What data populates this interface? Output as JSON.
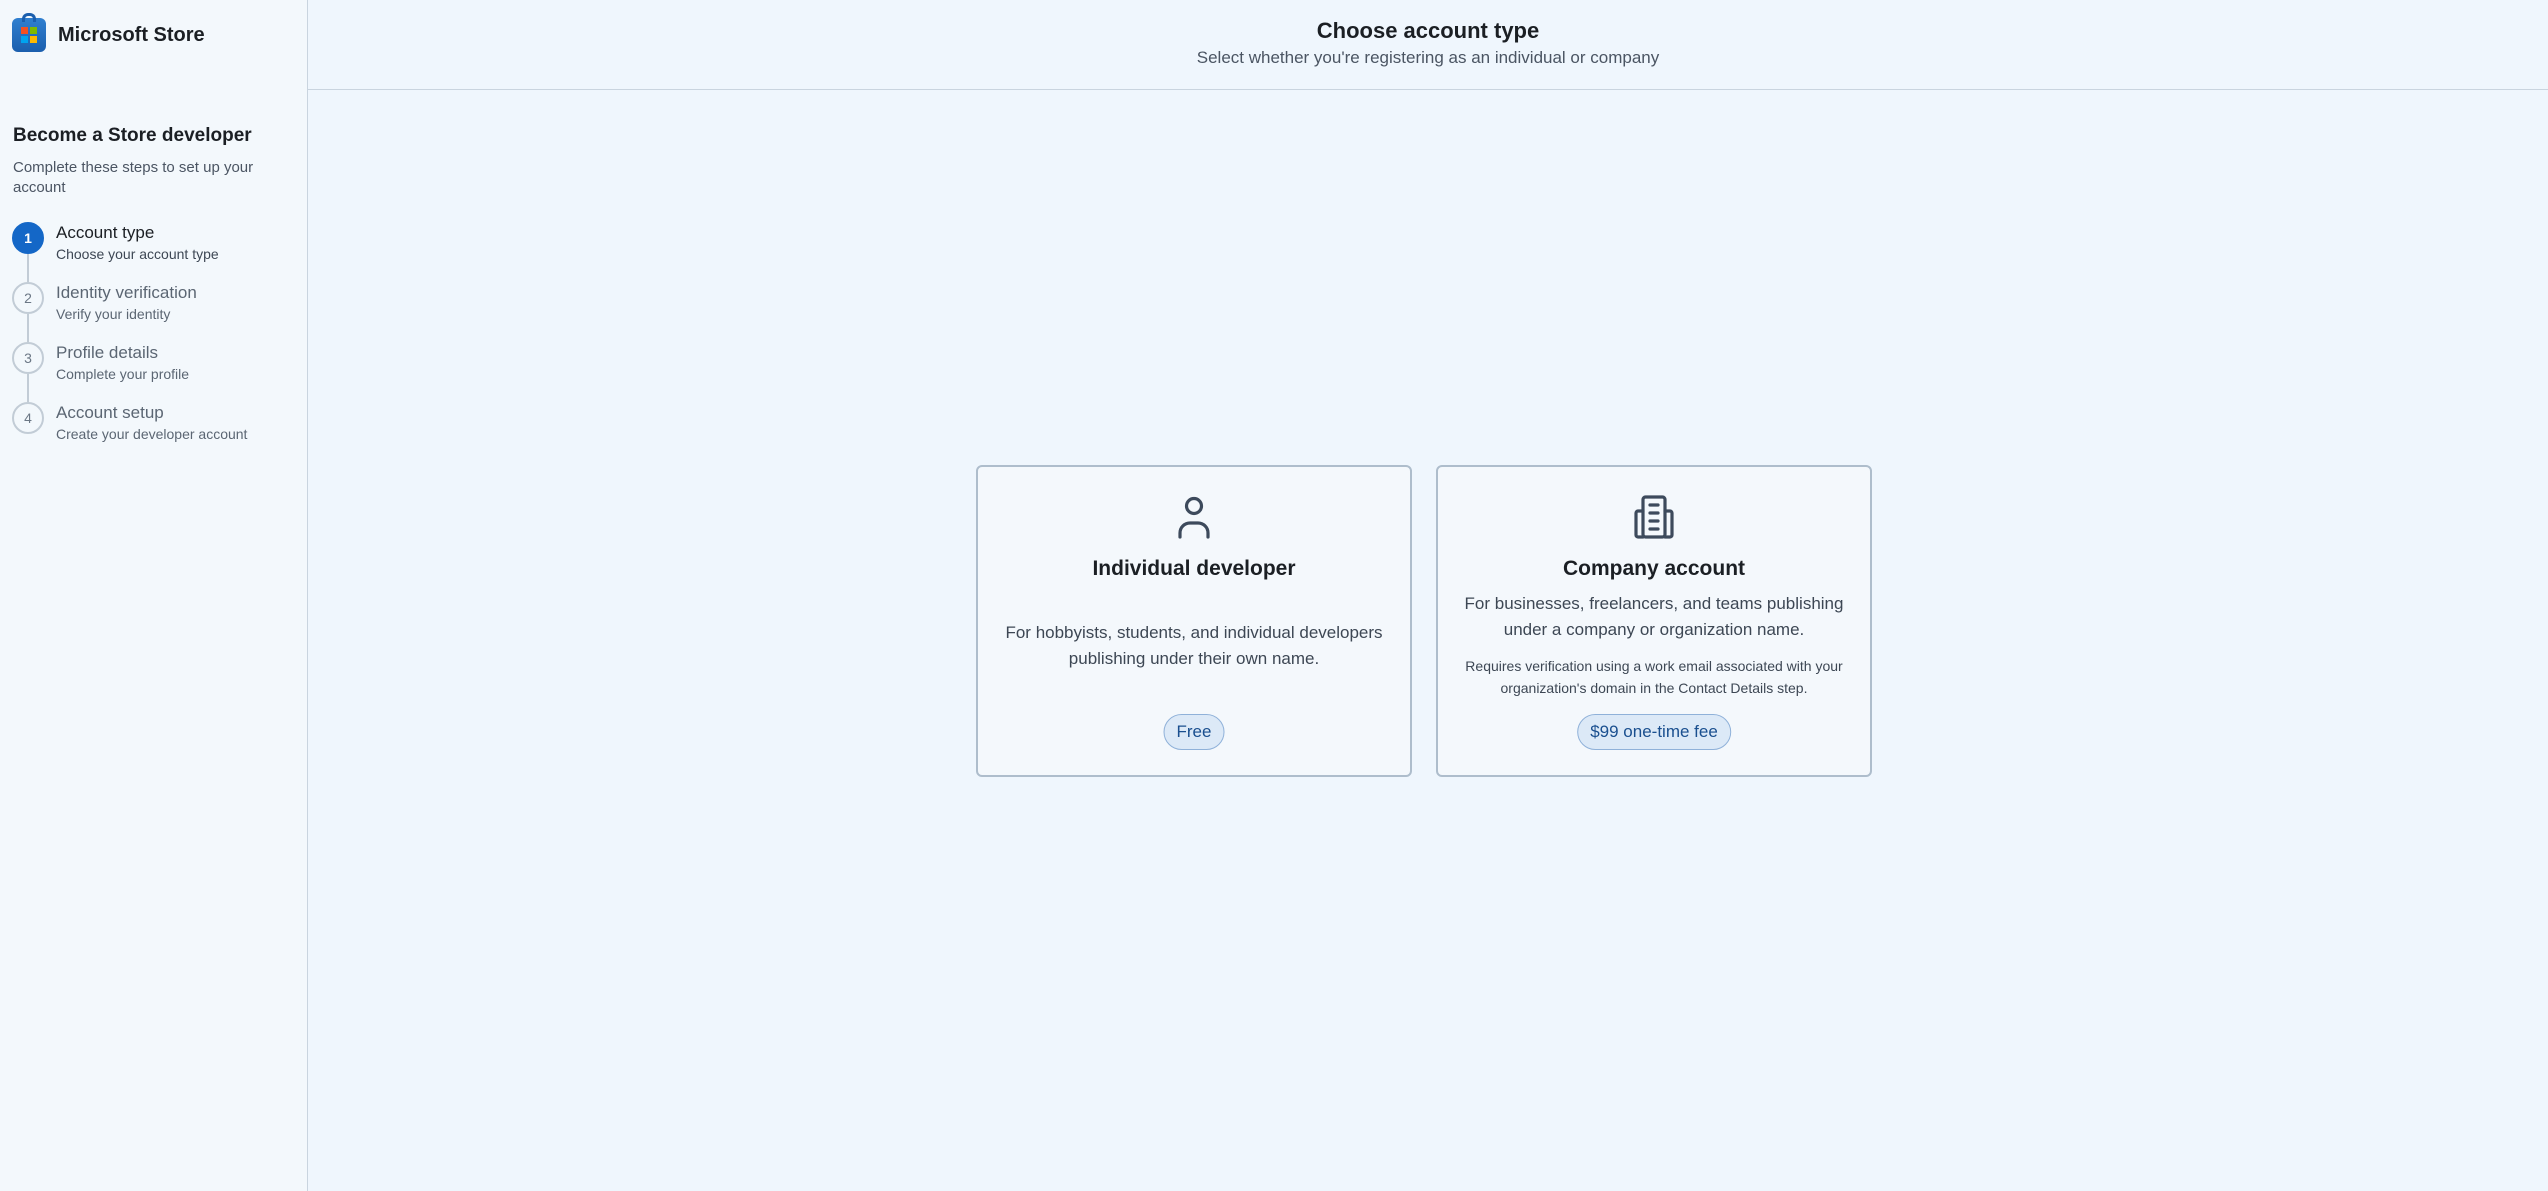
{
  "app": {
    "name": "Microsoft Store",
    "logo_colors": [
      "#f25022",
      "#7fba00",
      "#00a4ef",
      "#ffb900"
    ]
  },
  "sidebar": {
    "title": "Become a Store developer",
    "subtitle": "Complete these steps to set up your account",
    "steps": [
      {
        "number": "1",
        "title": "Account type",
        "description": "Choose your account type",
        "state": "active"
      },
      {
        "number": "2",
        "title": "Identity verification",
        "description": "Verify your identity",
        "state": "pending"
      },
      {
        "number": "3",
        "title": "Profile details",
        "description": "Complete your profile",
        "state": "pending"
      },
      {
        "number": "4",
        "title": "Account setup",
        "description": "Create your developer account",
        "state": "pending"
      }
    ]
  },
  "header": {
    "title": "Choose account type",
    "subtitle": "Select whether you're registering as an individual or company"
  },
  "cards": {
    "individual": {
      "icon": "person-icon",
      "title": "Individual developer",
      "description": "For hobbyists, students, and individual developers publishing under their own name.",
      "badge": "Free"
    },
    "company": {
      "icon": "building-icon",
      "title": "Company account",
      "description": "For businesses, freelancers, and teams publishing under a company or organization name.",
      "note": "Requires verification using a work email associated with your organization's domain in the Contact Details step.",
      "badge": "$99 one-time fee"
    }
  },
  "colors": {
    "accent": "#1467c7",
    "background": "#eff6fd",
    "card_border": "#aebdcc",
    "badge_bg": "#dce9f7",
    "badge_text": "#1a4f8f"
  }
}
